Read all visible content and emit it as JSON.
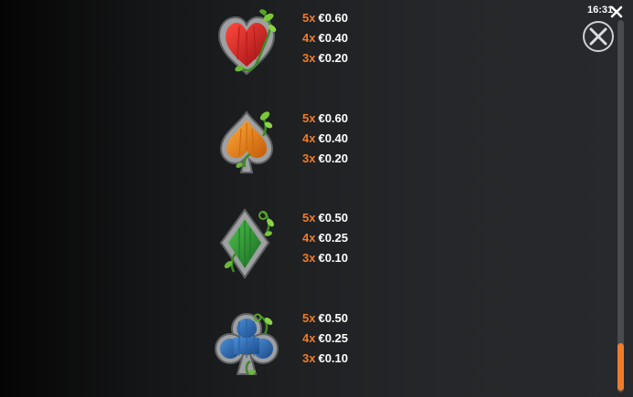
{
  "status": {
    "time": "16:31"
  },
  "controls": {
    "close_icon": "close-x-icon",
    "circle_close_icon": "circle-x-icon"
  },
  "colors": {
    "accent": "#f07c2a",
    "text": "#ffffff",
    "heart": "#d8282a",
    "spade": "#f08a12",
    "diamond": "#2e9a3a",
    "club": "#2f6fb8"
  },
  "scroll": {
    "position_fraction": 0.9
  },
  "symbols": [
    {
      "name": "heart",
      "icon": "heart-suit-icon",
      "payouts": [
        {
          "count": "5x",
          "value": "€0.60"
        },
        {
          "count": "4x",
          "value": "€0.40"
        },
        {
          "count": "3x",
          "value": "€0.20"
        }
      ]
    },
    {
      "name": "spade",
      "icon": "spade-suit-icon",
      "payouts": [
        {
          "count": "5x",
          "value": "€0.60"
        },
        {
          "count": "4x",
          "value": "€0.40"
        },
        {
          "count": "3x",
          "value": "€0.20"
        }
      ]
    },
    {
      "name": "diamond",
      "icon": "diamond-suit-icon",
      "payouts": [
        {
          "count": "5x",
          "value": "€0.50"
        },
        {
          "count": "4x",
          "value": "€0.25"
        },
        {
          "count": "3x",
          "value": "€0.10"
        }
      ]
    },
    {
      "name": "club",
      "icon": "club-suit-icon",
      "payouts": [
        {
          "count": "5x",
          "value": "€0.50"
        },
        {
          "count": "4x",
          "value": "€0.25"
        },
        {
          "count": "3x",
          "value": "€0.10"
        }
      ]
    }
  ]
}
